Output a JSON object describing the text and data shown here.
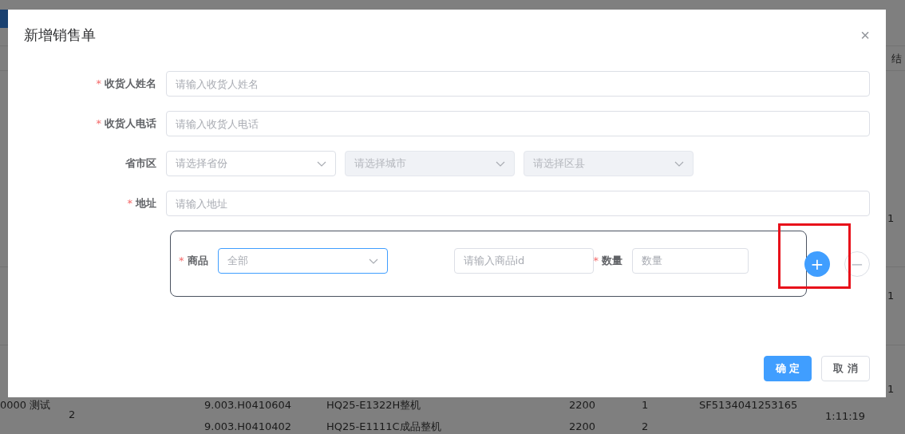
{
  "background": {
    "header_cells": [
      "结"
    ],
    "fragments": [
      "0000 测试",
      "2",
      "1",
      "1",
      "1"
    ],
    "rows": [
      {
        "cells": [
          "9.003.H0410604",
          "HQ25-E1322H整机",
          "2200",
          "1",
          "SF5134041253165",
          "1:11:19"
        ]
      },
      {
        "cells": [
          "9.003.H0410402",
          "HQ25-E1111C成品整机",
          "2200",
          "2"
        ]
      }
    ]
  },
  "dialog": {
    "title": "新增销售单",
    "close": "×",
    "fields": [
      {
        "kind": "input",
        "mark": "*",
        "label": "收货人姓名",
        "placeholder": "请输入收货人姓名"
      },
      {
        "kind": "input",
        "mark": "*",
        "label": "收货人电话",
        "placeholder": "请输入收货人电话"
      },
      {
        "kind": "region",
        "label": "省市区",
        "selects": [
          {
            "placeholder": "请选择省份",
            "disabled": false
          },
          {
            "placeholder": "请选择城市",
            "disabled": true
          },
          {
            "placeholder": "请选择区县",
            "disabled": true
          }
        ]
      },
      {
        "kind": "input",
        "mark": "*",
        "label": "地址",
        "placeholder": "请输入地址"
      }
    ],
    "product": {
      "mark": "*",
      "label": "商品",
      "select": {
        "value": "全部",
        "focused": true
      },
      "id_placeholder": "请输入商品id",
      "qty_mark": "*",
      "qty_label": "数量",
      "qty_placeholder": "数量",
      "add": "+",
      "remove": "−",
      "highlighted": true
    },
    "buttons": [
      {
        "label": "确 定",
        "kind": "primary"
      },
      {
        "label": "取 消",
        "kind": "default"
      }
    ]
  }
}
